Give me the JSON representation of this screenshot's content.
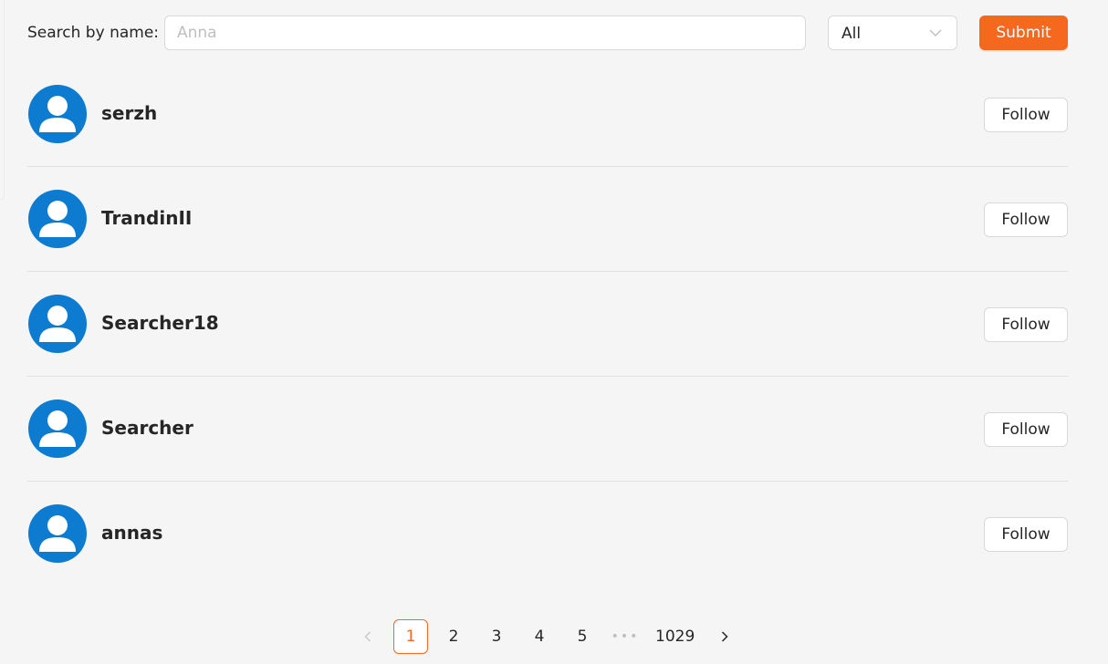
{
  "search": {
    "label": "Search by name:",
    "input_value": "",
    "placeholder": "Anna",
    "select_value": "All",
    "submit_label": "Submit"
  },
  "users": [
    {
      "name": "serzh",
      "follow_label": "Follow"
    },
    {
      "name": "TrandinII",
      "follow_label": "Follow"
    },
    {
      "name": "Searcher18",
      "follow_label": "Follow"
    },
    {
      "name": "Searcher",
      "follow_label": "Follow"
    },
    {
      "name": "annas",
      "follow_label": "Follow"
    }
  ],
  "pagination": {
    "prev_icon": "chevron-left-icon",
    "pages": [
      "1",
      "2",
      "3",
      "4",
      "5"
    ],
    "current_page": "1",
    "ellipsis": "•••",
    "last_page": "1029",
    "next_icon": "chevron-right-icon"
  },
  "colors": {
    "accent": "#f5681e",
    "avatar": "#0d7bd0",
    "background": "#f5f5f5"
  },
  "icons": {
    "avatar": "user-avatar-icon",
    "select": "chevron-down-icon"
  }
}
